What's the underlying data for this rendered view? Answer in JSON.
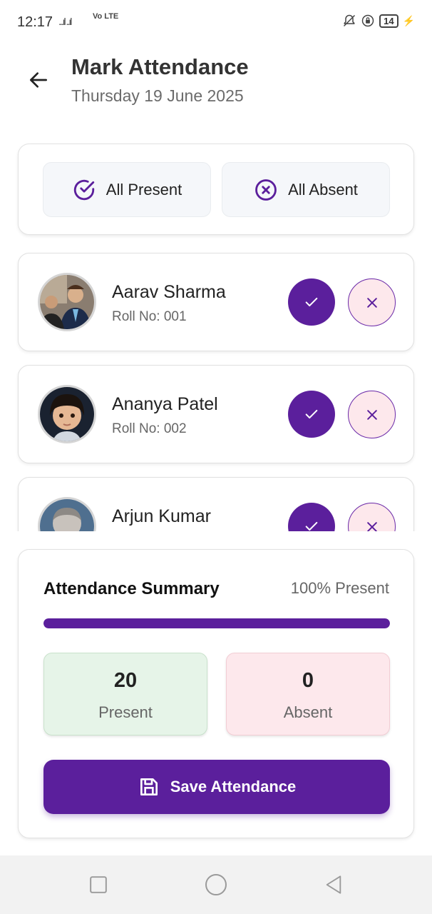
{
  "status_bar": {
    "time": "12:17",
    "signal": "...ıl ..ıl",
    "network": "Vo LTE",
    "battery": "14"
  },
  "header": {
    "title": "Mark Attendance",
    "date": "Thursday 19 June 2025",
    "back_icon": "arrow-left-icon"
  },
  "quick_actions": {
    "all_present_label": "All Present",
    "all_absent_label": "All Absent"
  },
  "students": [
    {
      "name": "Aarav Sharma",
      "roll": "Roll No: 001",
      "status": "present"
    },
    {
      "name": "Ananya Patel",
      "roll": "Roll No: 002",
      "status": "present"
    },
    {
      "name": "Arjun Kumar",
      "roll": "",
      "status": "present"
    }
  ],
  "summary": {
    "title": "Attendance Summary",
    "percent_text": "100% Present",
    "progress_fraction": 1.0,
    "present_count": "20",
    "present_label": "Present",
    "absent_count": "0",
    "absent_label": "Absent",
    "save_label": "Save Attendance"
  },
  "colors": {
    "primary": "#5b1f9c",
    "present_bg": "#e6f4e8",
    "absent_bg": "#fde8ec"
  }
}
